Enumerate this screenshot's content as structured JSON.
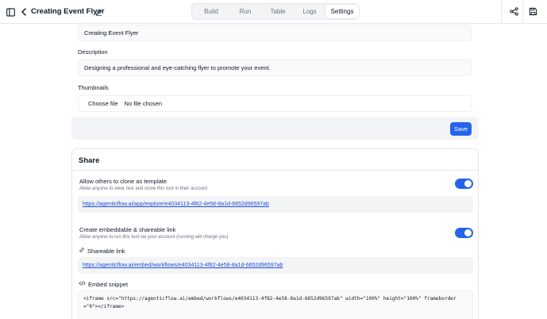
{
  "header": {
    "title": "Creating Event Flyer",
    "tabs": [
      {
        "label": "Build"
      },
      {
        "label": "Run"
      },
      {
        "label": "Table"
      },
      {
        "label": "Logs"
      },
      {
        "label": "Settings"
      }
    ],
    "active_tab": "Settings"
  },
  "settings_form": {
    "name_value": "Creating Event Flyer",
    "description_label": "Description",
    "description_value": "Designing a professional and eye-catching flyer to promote your event.",
    "thumbnails_label": "Thumbnails",
    "choose_file_label": "Choose file",
    "no_file_text": "No file chosen",
    "save_label": "Save"
  },
  "share": {
    "title": "Share",
    "clone": {
      "title": "Allow others to clone as template",
      "subtitle": "Allow anyone to view, test and clone this tool in their account",
      "enabled": true,
      "link": "https://agenticflow.ai/app/explore/e4034113-4f82-4e58-8a1d-6652d96597ab"
    },
    "embed": {
      "title": "Create embeddable & shareable link",
      "subtitle": "Allow anyone to run this tool via your account (running will charge you)",
      "enabled": true,
      "shareable_label": "Shareable link",
      "shareable_link": "https://agenticflow.ai/embed/workflows/e4034113-4f82-4e58-8a1d-6652d96597ab",
      "snippet_label": "Embed snippet",
      "snippet_code": "<iframe src=\"https://agenticflow.ai/embed/workflows/e4034113-4f82-4e58-8a1d-6652d96597ab\" width=\"100%\" height=\"100%\" frameborder=\"0\"></iframe>"
    }
  },
  "colors": {
    "accent": "#2563eb",
    "link": "#1d4ed8",
    "muted": "#6b7280"
  },
  "icons": [
    "sidebar-toggle-icon",
    "chevron-left-icon",
    "pencil-icon",
    "share-icon",
    "save-icon",
    "link-icon",
    "code-icon"
  ]
}
